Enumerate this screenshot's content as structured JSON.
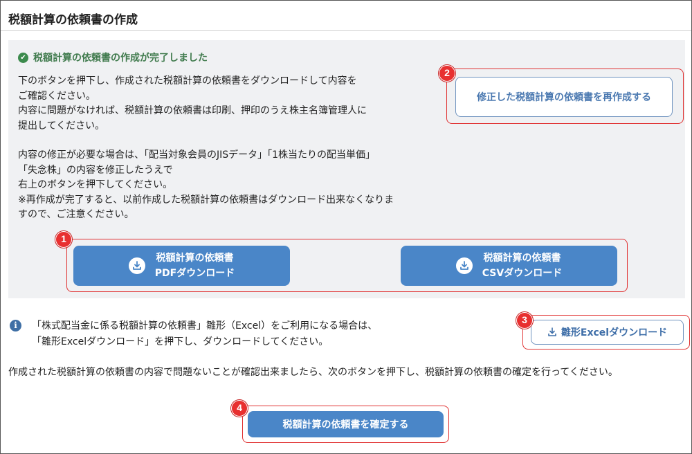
{
  "header": {
    "title": "税額計算の依頼書の作成"
  },
  "success": {
    "icon": "check-circle-icon",
    "message": "税額計算の依頼書の作成が完了しました"
  },
  "instructions": {
    "line1": "下のボタンを押下し、作成された税額計算の依頼書をダウンロードして内容を",
    "line2": "ご確認ください。",
    "line3": "内容に問題がなければ、税額計算の依頼書は印刷、押印のうえ株主名簿管理人に",
    "line4": "提出してください。"
  },
  "revision_note": {
    "line1": "内容の修正が必要な場合は、「配当対象会員のJISデータ」「1株当たりの配当単価」",
    "line2": "「失念株」の内容を修正したうえで",
    "line3": "右上のボタンを押下してください。",
    "line4": "※再作成が完了すると、以前作成した税額計算の依頼書はダウンロード出来なくなりま",
    "line5": "すので、ご注意ください。"
  },
  "buttons": {
    "recreate": "修正した税額計算の依頼書を再作成する",
    "pdf_line1": "税額計算の依頼書",
    "pdf_line2": "PDFダウンロード",
    "csv_line1": "税額計算の依頼書",
    "csv_line2": "CSVダウンロード",
    "excel": "雛形Excelダウンロード",
    "confirm": "税額計算の依頼書を確定する"
  },
  "info": {
    "icon": "info-icon",
    "line1": "「株式配当金に係る税額計算の依頼書」雛形（Excel）をご利用になる場合は、",
    "line2": "「雛形Excelダウンロード」を押下し、ダウンロードしてください。"
  },
  "confirm_text": "作成された税額計算の依頼書の内容で問題ないことが確認出来ましたら、次のボタンを押下し、税額計算の依頼書の確定を行ってください。",
  "callouts": [
    "1",
    "2",
    "3",
    "4"
  ],
  "colors": {
    "primary": "#4a86c8",
    "success": "#3f7a4c",
    "highlight": "#e03030",
    "panel": "#f0f1f3"
  }
}
